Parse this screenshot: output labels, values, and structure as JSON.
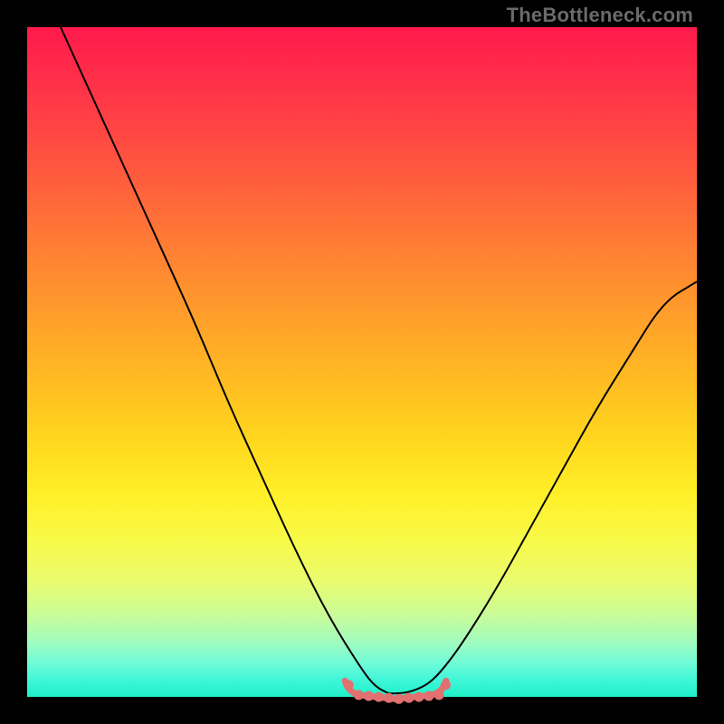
{
  "watermark": "TheBottleneck.com",
  "colors": {
    "background": "#000000",
    "curve": "#000000",
    "markers": "#e17070"
  },
  "chart_data": {
    "type": "line",
    "title": "",
    "xlabel": "",
    "ylabel": "",
    "xlim": [
      0,
      100
    ],
    "ylim": [
      0,
      100
    ],
    "grid": false,
    "legend": false,
    "note": "Values are visual estimates read off the unlabeled gradient chart; y is bottleneck penalty (0 = ideal) with minimum near x≈55.",
    "x": [
      5,
      10,
      15,
      20,
      25,
      30,
      35,
      40,
      45,
      50,
      52,
      54,
      56,
      58,
      60,
      62,
      65,
      70,
      75,
      80,
      85,
      90,
      95,
      100
    ],
    "y": [
      100,
      89,
      78,
      67,
      56,
      44,
      33,
      22,
      12,
      4,
      1.5,
      0.5,
      0.5,
      1,
      2,
      4,
      8,
      16,
      25,
      34,
      43,
      51,
      59,
      62
    ],
    "optimal_band": {
      "x_start": 48,
      "x_end": 62,
      "y": 0.5
    },
    "marker_dots_x": [
      48,
      49.5,
      51,
      52.5,
      54,
      55.5,
      57,
      58.5,
      60,
      61.5,
      62.5
    ]
  }
}
